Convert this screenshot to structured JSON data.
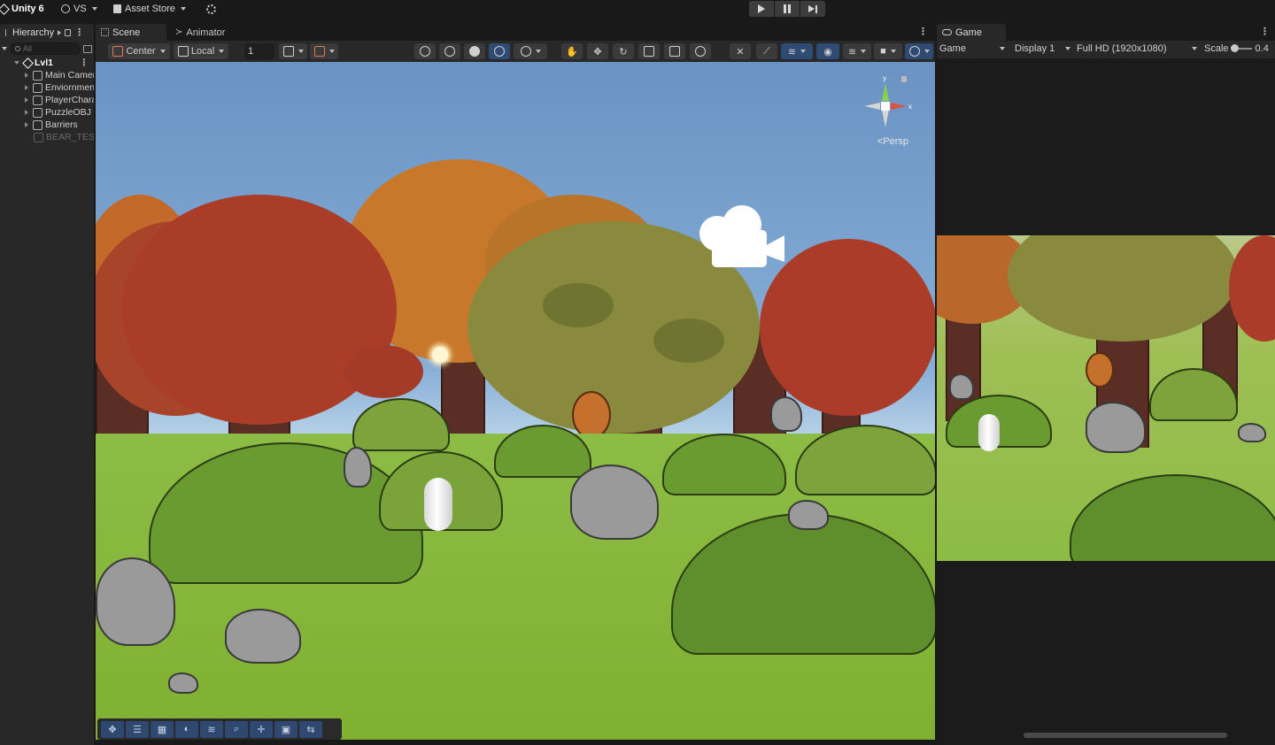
{
  "topbar": {
    "app_name": "Unity 6",
    "account": "VS",
    "asset_store": "Asset Store"
  },
  "hierarchy": {
    "tab_label": "Hierarchy",
    "search_placeholder": "All",
    "scene_name": "Lvl1",
    "items": [
      {
        "label": "Main Camera",
        "enabled": true
      },
      {
        "label": "Enviornment",
        "enabled": true
      },
      {
        "label": "PlayerCharacter",
        "enabled": true
      },
      {
        "label": "PuzzleOBJ",
        "enabled": true
      },
      {
        "label": "Barriers",
        "enabled": true
      },
      {
        "label": "BEAR_TEST",
        "enabled": false
      }
    ]
  },
  "scene": {
    "tabs": [
      {
        "label": "Scene",
        "active": true
      },
      {
        "label": "Animator",
        "active": false
      }
    ],
    "toolbar": {
      "pivot": "Center",
      "space": "Local",
      "snap_value": "1"
    },
    "view_mode": "Persp",
    "gizmo_axes": {
      "x": "x",
      "y": "y"
    }
  },
  "game": {
    "tab_label": "Game",
    "mode": "Game",
    "display": "Display 1",
    "resolution": "Full HD (1920x1080)",
    "scale_label": "Scale",
    "scale_value": "0.4"
  },
  "colors": {
    "accent_blue": "#2f4a73",
    "panel": "#282828",
    "bar": "#191919"
  }
}
